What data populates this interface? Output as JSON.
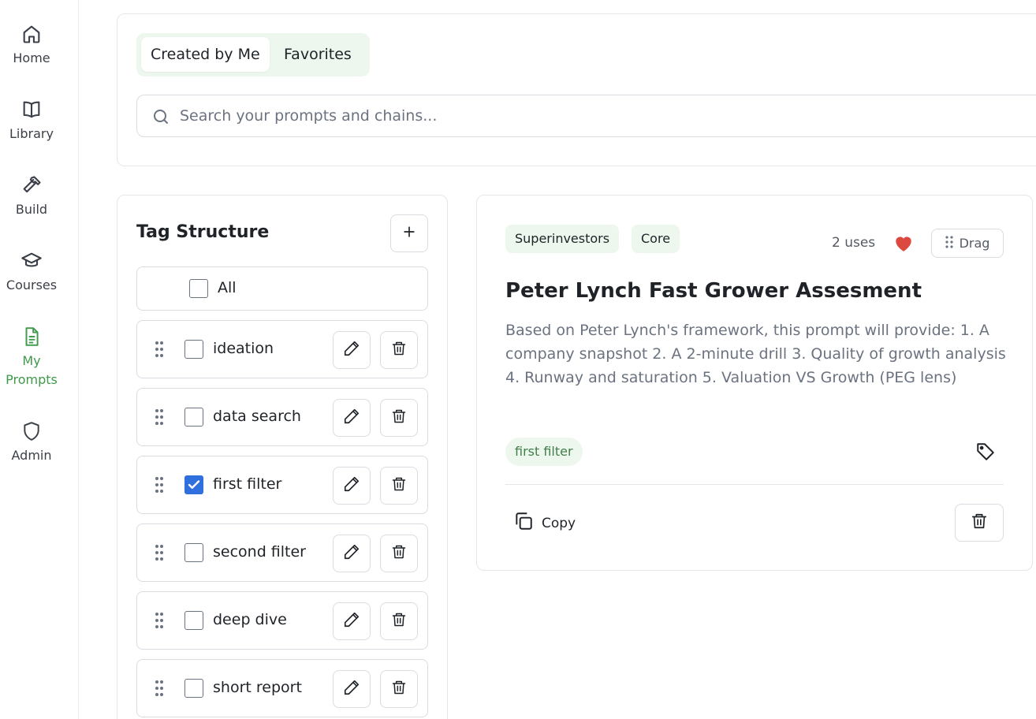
{
  "sidebar": {
    "items": [
      {
        "label": "Home",
        "icon": "home-icon"
      },
      {
        "label": "Library",
        "icon": "book-icon"
      },
      {
        "label": "Build",
        "icon": "hammer-icon"
      },
      {
        "label": "Courses",
        "icon": "graduation-cap-icon"
      },
      {
        "label": "My\nPrompts",
        "label_line1": "My",
        "label_line2": "Prompts",
        "icon": "document-icon",
        "active": true
      },
      {
        "label": "Admin",
        "icon": "shield-icon"
      }
    ]
  },
  "filters": {
    "tabs": [
      {
        "label": "Created by Me",
        "selected": true
      },
      {
        "label": "Favorites",
        "selected": false
      }
    ],
    "search": {
      "placeholder": "Search your prompts and chains...",
      "value": ""
    }
  },
  "tag_structure": {
    "title": "Tag Structure",
    "all_label": "All",
    "tags": [
      {
        "label": "ideation",
        "checked": false
      },
      {
        "label": "data search",
        "checked": false
      },
      {
        "label": "first filter",
        "checked": true
      },
      {
        "label": "second filter",
        "checked": false
      },
      {
        "label": "deep dive",
        "checked": false
      },
      {
        "label": "short report",
        "checked": false
      }
    ]
  },
  "prompt_card": {
    "categories": [
      "Superinvestors",
      "Core"
    ],
    "uses": "2 uses",
    "favorited": true,
    "drag_label": "Drag",
    "title": "Peter Lynch Fast Grower Assesment",
    "description": "Based on Peter Lynch's framework, this prompt will provide: 1. A company snapshot 2. A 2-minute drill 3. Quality of growth analysis 4. Runway and saturation 5. Valuation VS Growth (PEG lens)",
    "tag": "first filter",
    "copy_label": "Copy"
  },
  "colors": {
    "accent_green": "#3f9a4b",
    "chip_bg": "#edf7ee",
    "heart_red": "#dc4a3f",
    "checkbox_blue": "#2f6fde"
  }
}
